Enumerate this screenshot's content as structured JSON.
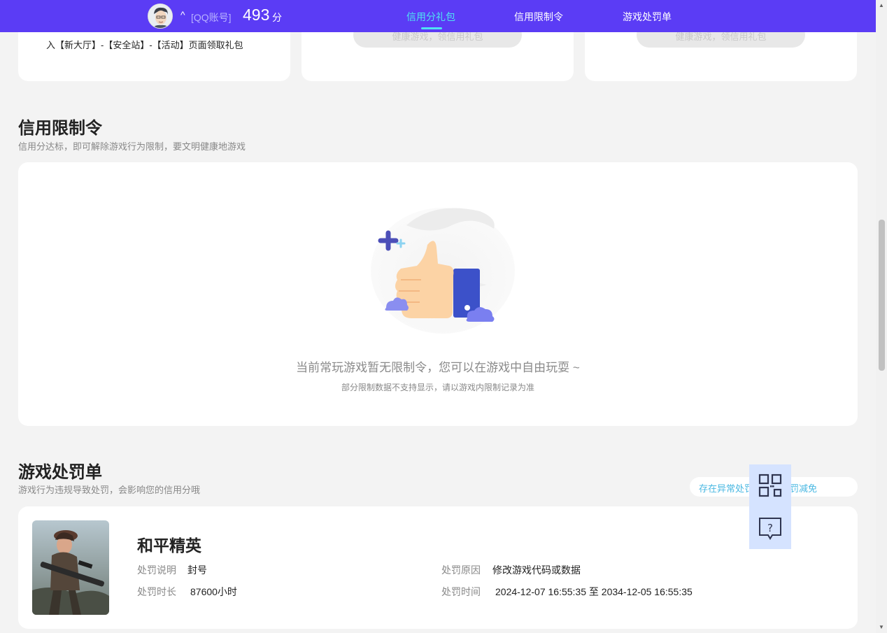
{
  "header": {
    "caret": "^",
    "account_label": "[QQ账号]",
    "score": "493",
    "score_unit": "分",
    "tabs": [
      {
        "label": "信用分礼包",
        "active": true
      },
      {
        "label": "信用限制令",
        "active": false
      },
      {
        "label": "游戏处罚单",
        "active": false
      }
    ]
  },
  "gift_cards": {
    "card1_text": "入【新大厅】-【安全站】-【活动】页面领取礼包",
    "card2_button": "健康游戏，领信用礼包",
    "card3_button": "健康游戏，领信用礼包"
  },
  "restriction": {
    "title": "信用限制令",
    "subtitle": "信用分达标，即可解除游戏行为限制，要文明健康地游戏",
    "empty_main": "当前常玩游戏暂无限制令，您可以在游戏中自由玩耍 ~",
    "empty_sub": "部分限制数据不支持显示，请以游戏内限制记录为准"
  },
  "penalty": {
    "title": "游戏处罚单",
    "subtitle": "游戏行为违规导致处罚，会影响您的信用分哦",
    "appeal": "存在异常处罚？申请处罚减免",
    "items": [
      {
        "game": "和平精英",
        "desc_label": "处罚说明",
        "desc_value": "封号",
        "duration_label": "处罚时长",
        "duration_value": "87600小时",
        "reason_label": "处罚原因",
        "reason_value": "修改游戏代码或数据",
        "time_label": "处罚时间",
        "time_value": "2024-12-07 16:55:35 至 2034-12-05 16:55:35"
      }
    ]
  },
  "float_toolbar": {
    "icons": [
      "qr-code-icon",
      "help-chat-icon"
    ]
  },
  "colors": {
    "header_bg": "#5b3cf5",
    "active_tab": "#4fe3f2",
    "appeal_text": "#4ab8e2"
  }
}
